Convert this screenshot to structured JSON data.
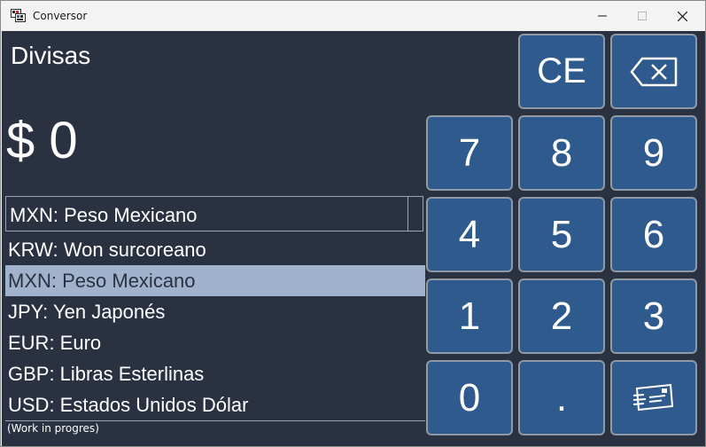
{
  "window": {
    "title": "Conversor"
  },
  "main": {
    "mode_title": "Divisas",
    "display_value": "$ 0",
    "combo_selected": "MXN: Peso Mexicano",
    "currencies": [
      "KRW: Won surcoreano",
      "MXN: Peso Mexicano",
      "JPY: Yen Japonés",
      "EUR: Euro",
      "GBP: Libras Esterlinas",
      "USD: Estados Unidos Dólar"
    ],
    "selected_index": 1,
    "footer_note": "(Work in progres)"
  },
  "keypad": {
    "ce": "CE",
    "seven": "7",
    "eight": "8",
    "nine": "9",
    "four": "4",
    "five": "5",
    "six": "6",
    "one": "1",
    "two": "2",
    "three": "3",
    "zero": "0",
    "dot": ".",
    "backspace_icon": "backspace-icon",
    "convert_icon": "convert-icon"
  },
  "colors": {
    "background": "#2a3242",
    "key": "#2f5a8d",
    "key_border": "#8f99a6",
    "selected_item": "#a0b2cc"
  }
}
